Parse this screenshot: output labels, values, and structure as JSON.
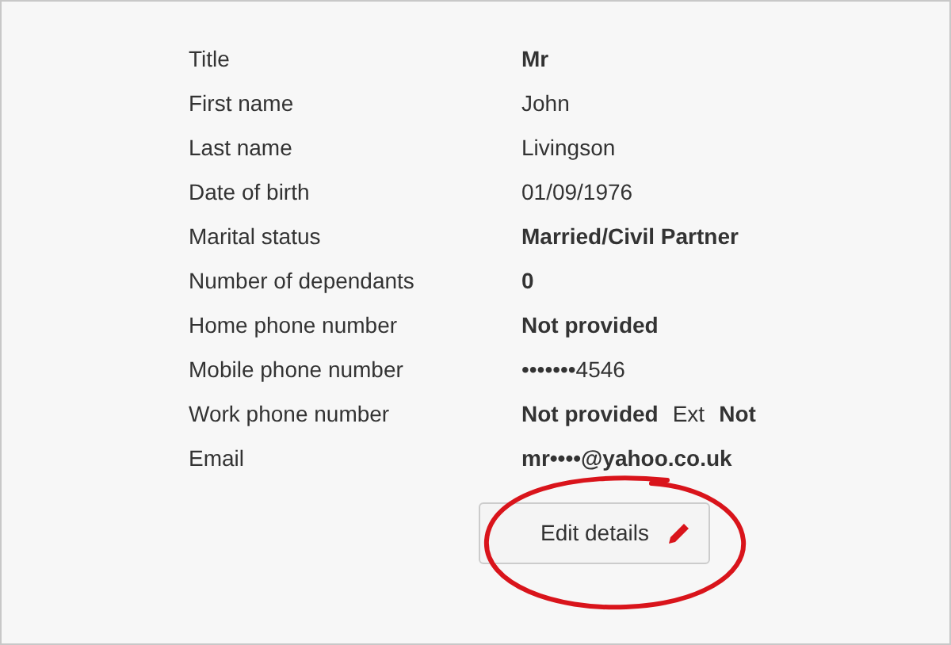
{
  "details": [
    {
      "label": "Title",
      "value": [
        {
          "text": "Mr",
          "bold": true
        }
      ]
    },
    {
      "label": "First name",
      "value": [
        {
          "text": "John",
          "bold": false
        }
      ]
    },
    {
      "label": "Last name",
      "value": [
        {
          "text": "Livingson",
          "bold": false
        }
      ]
    },
    {
      "label": "Date of birth",
      "value": [
        {
          "text": "01/09/1976",
          "bold": false
        }
      ]
    },
    {
      "label": "Marital status",
      "value": [
        {
          "text": "Married/Civil Partner",
          "bold": true
        }
      ]
    },
    {
      "label": "Number of dependants",
      "value": [
        {
          "text": "0",
          "bold": true
        }
      ]
    },
    {
      "label": "Home phone number",
      "value": [
        {
          "text": "Not provided",
          "bold": true
        }
      ]
    },
    {
      "label": "Mobile phone number",
      "value": [
        {
          "text": "•••••••4546",
          "bold": false
        }
      ]
    },
    {
      "label": "Work phone number",
      "value": [
        {
          "text": "Not provided",
          "bold": true
        },
        {
          "text": "Ext",
          "bold": false
        },
        {
          "text": "Not",
          "bold": true
        }
      ]
    },
    {
      "label": "Email",
      "value": [
        {
          "text": "mr••••@yahoo.co.uk",
          "bold": true
        }
      ]
    }
  ],
  "edit_button": {
    "label": "Edit details",
    "annotated": true
  }
}
